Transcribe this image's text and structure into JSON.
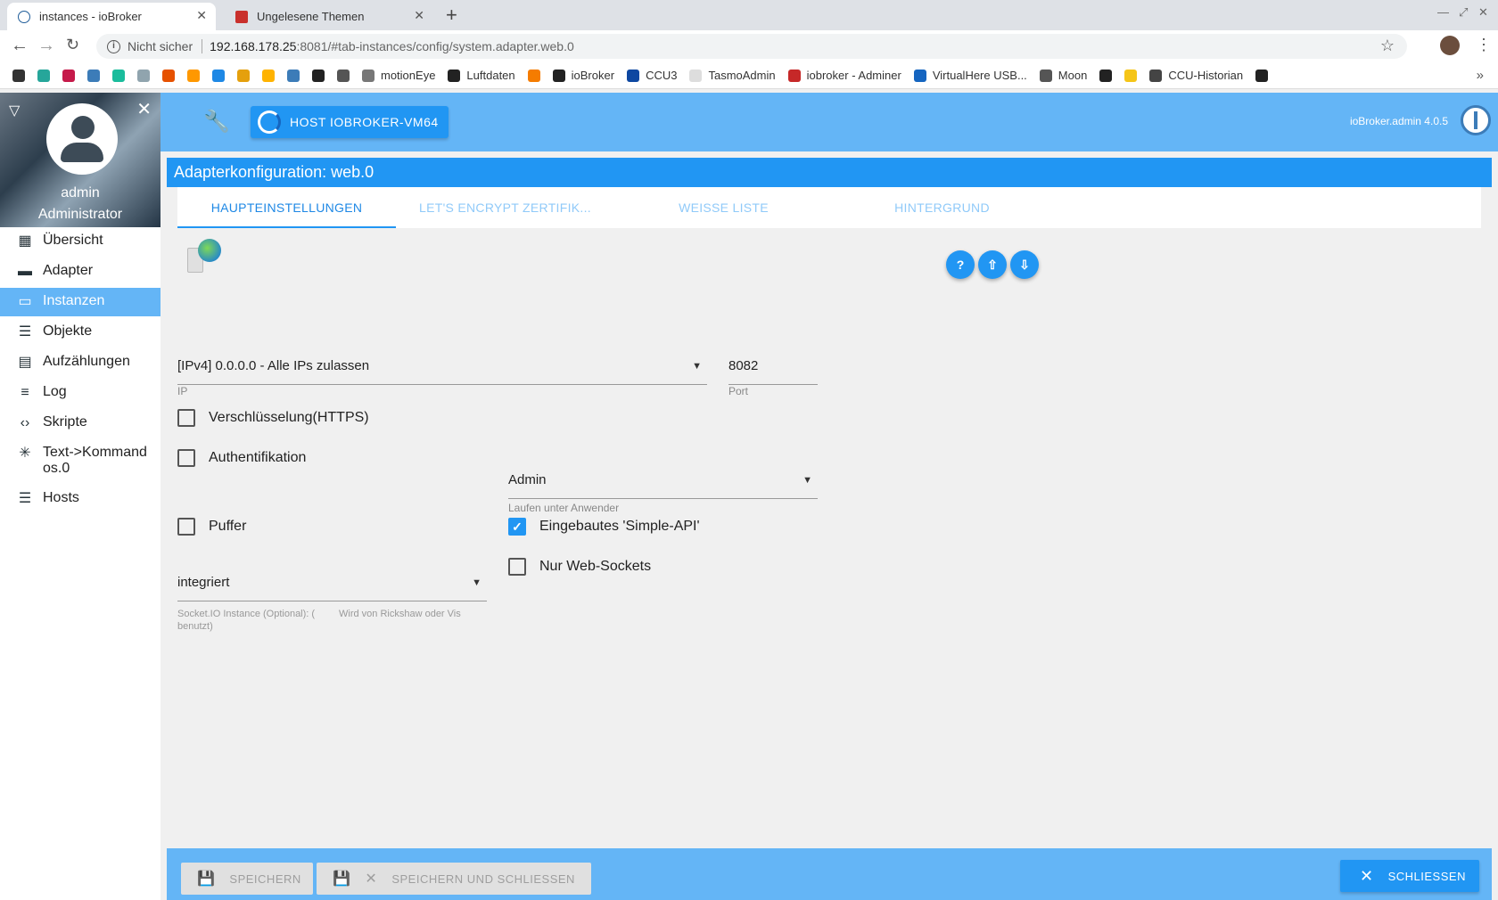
{
  "browser": {
    "tabs": [
      {
        "title": "instances - ioBroker",
        "active": true
      },
      {
        "title": "Ungelesene Themen",
        "active": false
      }
    ],
    "address": {
      "security_label": "Nicht sicher",
      "host": "192.168.178.25",
      "path": ":8081/#tab-instances/config/system.adapter.web.0"
    },
    "bookmarks": [
      {
        "label": "",
        "icon": "star-bookmark-icon",
        "color": "#333333"
      },
      {
        "label": "",
        "icon": "y-icon",
        "color": "#26a69a"
      },
      {
        "label": "",
        "icon": "raspberry-icon",
        "color": "#c51a4a"
      },
      {
        "label": "",
        "icon": "iobroker-icon",
        "color": "#3c7cb8"
      },
      {
        "label": "",
        "icon": "cloud-icon",
        "color": "#1abc9c"
      },
      {
        "label": "",
        "icon": "gauge-icon",
        "color": "#90a4ae"
      },
      {
        "label": "",
        "icon": "x-icon",
        "color": "#e65100"
      },
      {
        "label": "",
        "icon": "diamond-icon",
        "color": "#ff9800"
      },
      {
        "label": "",
        "icon": "dsm-icon",
        "color": "#1e88e5"
      },
      {
        "label": "",
        "icon": "plex-icon",
        "color": "#e5a00d"
      },
      {
        "label": "",
        "icon": "wand-icon",
        "color": "#ffb300"
      },
      {
        "label": "",
        "icon": "iobroker-icon",
        "color": "#3c7cb8"
      },
      {
        "label": "",
        "icon": "plus-circle-icon",
        "color": "#222222"
      },
      {
        "label": "",
        "icon": "flot-icon",
        "color": "#555555"
      },
      {
        "label": "motionEye",
        "icon": "motioneye-icon",
        "color": "#777777"
      },
      {
        "label": "Luftdaten",
        "icon": "globe-icon",
        "color": "#222222"
      },
      {
        "label": "",
        "icon": "grafana-icon",
        "color": "#f57c00"
      },
      {
        "label": "ioBroker",
        "icon": "github-icon",
        "color": "#222222"
      },
      {
        "label": "CCU3",
        "icon": "ccu-icon",
        "color": "#0d47a1"
      },
      {
        "label": "TasmoAdmin",
        "icon": "bulb-icon",
        "color": "#dddddd"
      },
      {
        "label": "iobroker - Adminer",
        "icon": "adminer-icon",
        "color": "#c62828"
      },
      {
        "label": "VirtualHere USB...",
        "icon": "virtualhere-icon",
        "color": "#1565c0"
      },
      {
        "label": "Moon",
        "icon": "flot-icon",
        "color": "#555555"
      },
      {
        "label": "",
        "icon": "snowflake-icon",
        "color": "#222222"
      },
      {
        "label": "",
        "icon": "imdb-icon",
        "color": "#f5c518"
      },
      {
        "label": "CCU-Historian",
        "icon": "historian-icon",
        "color": "#444444"
      },
      {
        "label": "",
        "icon": "globe-icon",
        "color": "#222222"
      }
    ]
  },
  "user": {
    "name": "admin",
    "role": "Administrator"
  },
  "nav": [
    {
      "label": "Übersicht",
      "icon": "grid-icon",
      "active": false
    },
    {
      "label": "Adapter",
      "icon": "store-icon",
      "active": false
    },
    {
      "label": "Instanzen",
      "icon": "instances-icon",
      "active": true
    },
    {
      "label": "Objekte",
      "icon": "list-icon",
      "active": false
    },
    {
      "label": "Aufzählungen",
      "icon": "enum-icon",
      "active": false
    },
    {
      "label": "Log",
      "icon": "log-icon",
      "active": false
    },
    {
      "label": "Skripte",
      "icon": "code-icon",
      "active": false
    },
    {
      "label": "Text->Kommandos.0",
      "icon": "snowflake-icon",
      "active": false
    },
    {
      "label": "Hosts",
      "icon": "hosts-icon",
      "active": false
    }
  ],
  "topbar": {
    "host_button": "HOST IOBROKER-VM64",
    "version": "ioBroker.admin 4.0.5"
  },
  "config": {
    "title": "Adapterkonfiguration: web.0",
    "tabs": [
      {
        "label": "HAUPTEINSTELLUNGEN",
        "active": true
      },
      {
        "label": "LET'S ENCRYPT ZERTIFIK...",
        "active": false
      },
      {
        "label": "WEISSE LISTE",
        "active": false
      },
      {
        "label": "HINTERGRUND",
        "active": false
      }
    ],
    "ip": {
      "value": "[IPv4] 0.0.0.0 - Alle IPs zulassen",
      "label": "IP"
    },
    "port": {
      "value": "8082",
      "label": "Port"
    },
    "https": {
      "label": "Verschlüsselung(HTTPS)",
      "checked": false
    },
    "auth": {
      "label": "Authentifikation",
      "checked": false
    },
    "run_as": {
      "value": "Admin",
      "label": "Laufen unter Anwender"
    },
    "cache": {
      "label": "Puffer",
      "checked": false
    },
    "simple_api": {
      "label": "Eingebautes 'Simple-API'",
      "checked": true
    },
    "websockets": {
      "label": "Nur Web-Sockets",
      "checked": false
    },
    "socketio": {
      "value": "integriert",
      "helper_left": "Socket.IO Instance (Optional): (\nbenutzt)",
      "helper_right": "Wird von Rickshaw oder Vis"
    }
  },
  "footer": {
    "save": "SPEICHERN",
    "save_close": "SPEICHERN UND SCHLIESSEN",
    "close": "SCHLIESSEN"
  }
}
